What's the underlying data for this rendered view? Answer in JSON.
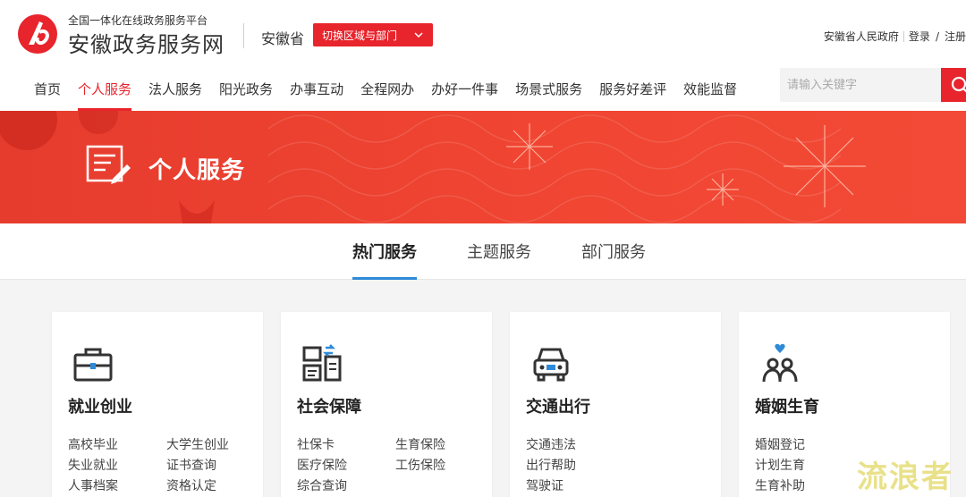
{
  "header": {
    "brand_subtitle": "全国一体化在线政务服务平台",
    "brand_title": "安徽政务服务网",
    "province": "安徽省",
    "region_button": "切换区域与部门",
    "top_links": {
      "government": "安徽省人民政府",
      "login": "登录",
      "register": "注册"
    }
  },
  "nav": {
    "items": [
      "首页",
      "个人服务",
      "法人服务",
      "阳光政务",
      "办事互动",
      "全程网办",
      "办好一件事",
      "场景式服务",
      "服务好差评",
      "效能监督"
    ],
    "active_index": 1
  },
  "search": {
    "placeholder": "请输入关键字"
  },
  "banner": {
    "title": "个人服务"
  },
  "tabs": {
    "items": [
      "热门服务",
      "主题服务",
      "部门服务"
    ],
    "active_index": 0
  },
  "cards": [
    {
      "title": "就业创业",
      "icon": "briefcase-icon",
      "links": [
        "高校毕业",
        "大学生创业",
        "失业就业",
        "证书查询",
        "人事档案",
        "资格认定"
      ]
    },
    {
      "title": "社会保障",
      "icon": "social-security-icon",
      "links": [
        "社保卡",
        "生育保险",
        "医疗保险",
        "工伤保险",
        "综合查询"
      ]
    },
    {
      "title": "交通出行",
      "icon": "car-icon",
      "links": [
        "交通违法",
        "出行帮助",
        "驾驶证"
      ]
    },
    {
      "title": "婚姻生育",
      "icon": "couple-icon",
      "links": [
        "婚姻登记",
        "计划生育",
        "生育补助"
      ]
    }
  ],
  "colors": {
    "accent_red": "#e8242c",
    "tab_blue": "#2f8ad8",
    "icon_blue": "#2f8ad8"
  },
  "watermark": "流浪者"
}
